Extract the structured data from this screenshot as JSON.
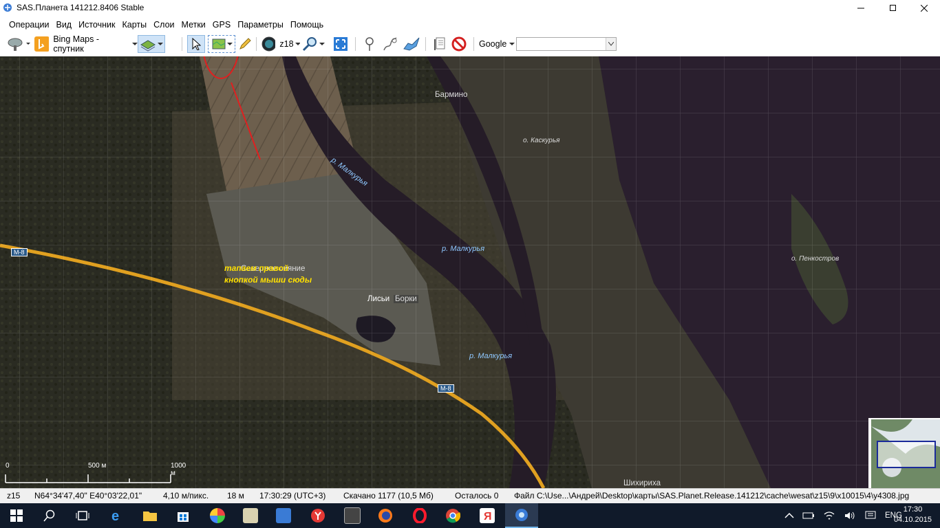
{
  "window": {
    "title": "SAS.Планета 141212.8406 Stable"
  },
  "menu": [
    "Операции",
    "Вид",
    "Источник",
    "Карты",
    "Слои",
    "Метки",
    "GPS",
    "Параметры",
    "Помощь"
  ],
  "toolbar": {
    "map_source": "Bing Maps - спутник",
    "zoom": "z18",
    "search_provider": "Google",
    "search_value": ""
  },
  "map": {
    "labels": {
      "barmino": "Бармино",
      "kaskurya": "о. Каскурья",
      "river1": "р. Малкурья",
      "river2": "р. Малкурья",
      "river3": "р. Малкурья",
      "penkostrov": "о. Пенкостров",
      "village_overlay": "Северное сияние",
      "lisi": "Лисьи",
      "borki": "Борки",
      "shikhirikha": "Шихириха",
      "road1": "М-8",
      "road2": "М-8"
    },
    "annotation": [
      "тапаем правой",
      "кнопкой мыши сюды"
    ],
    "scale": {
      "t0": "0",
      "t500": "500 м",
      "t1000": "1000 м"
    }
  },
  "status": {
    "zoom": "z15",
    "coords": "N64°34'47,40\" E40°03'22,01\"",
    "resolution": "4,10 м/пикс.",
    "distance": "18 м",
    "time": "17:30:29 (UTC+3)",
    "downloaded": "Скачано 1177 (10,5 Мб)",
    "remaining": "Осталось 0",
    "file": "Файл C:\\Use...\\Андрей\\Desktop\\карты\\SAS.Planet.Release.141212\\cache\\wesat\\z15\\9\\x10015\\4\\y4308.jpg"
  },
  "taskbar": {
    "lang": "ENG",
    "time": "17:30",
    "date": "04.10.2015"
  },
  "colors": {
    "accent": "#e02020",
    "annotation": "#ffe000",
    "river": "#2a1f2e",
    "road": "#e0a020"
  }
}
